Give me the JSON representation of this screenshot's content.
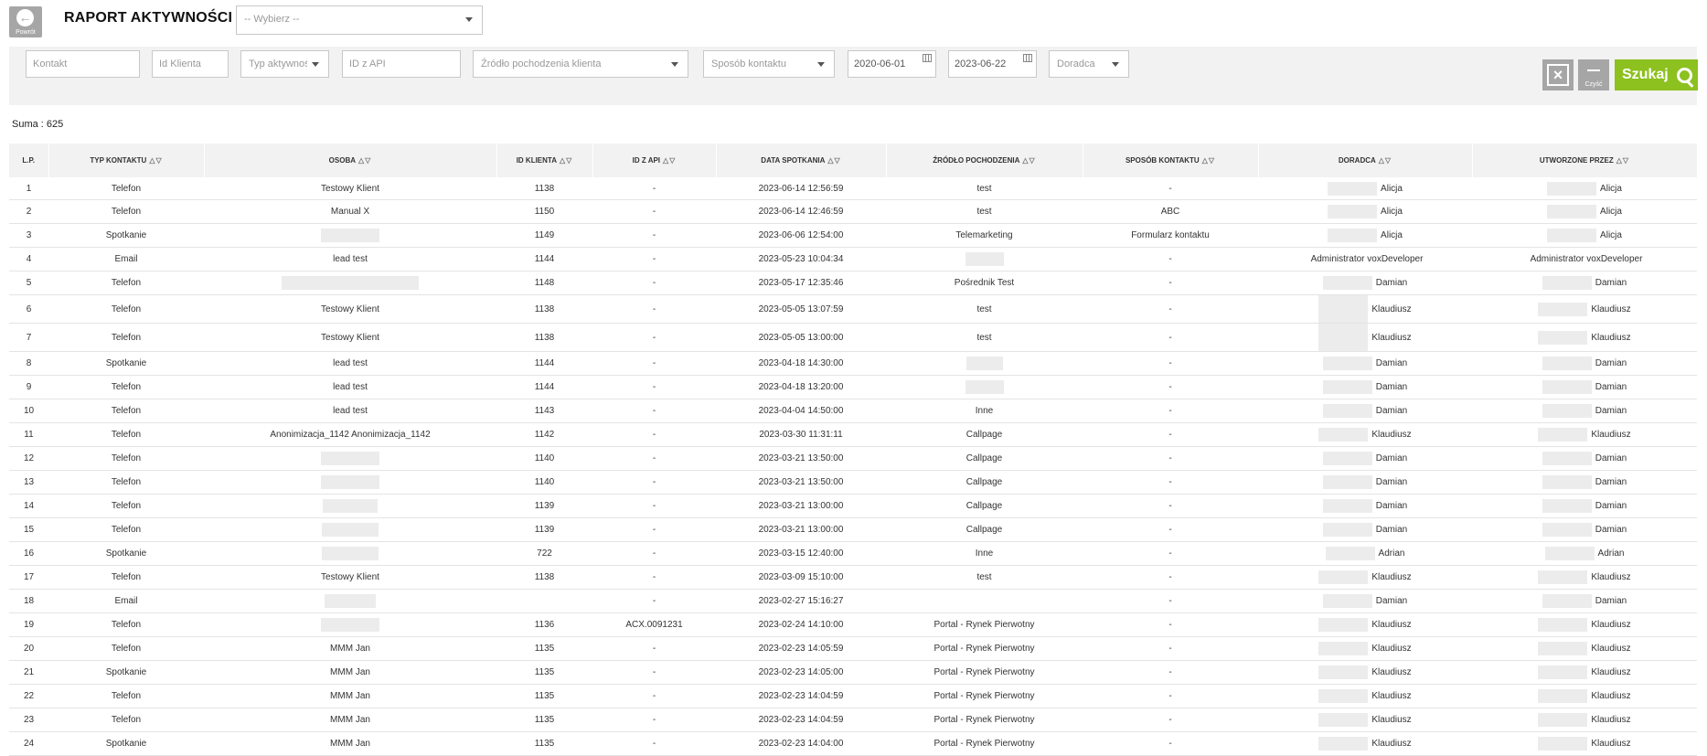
{
  "header": {
    "back_label": "Powrót",
    "title": "RAPORT AKTYWNOŚCI",
    "report_select": "-- Wybierz --"
  },
  "filters": {
    "kontakt_placeholder": "Kontakt",
    "id_klienta_placeholder": "Id Klienta",
    "typ_aktywnosci": "Typ aktywności",
    "id_z_api_placeholder": "ID z API",
    "zrodlo": "Źródło pochodzenia klienta",
    "sposob_kontaktu": "Sposób kontaktu",
    "date_from": "2020-06-01",
    "date_to": "2023-06-22",
    "doradca": "Doradca",
    "clear_label": "Czyść",
    "search_label": "Szukaj"
  },
  "summary": "Suma : 625",
  "table": {
    "columns": [
      "L.P.",
      "TYP KONTAKTU",
      "OSOBA",
      "ID KLIENTA",
      "ID Z API",
      "DATA SPOTKANIA",
      "ŹRÓDŁO POCHODZENIA",
      "SPOSÓB KONTAKTU",
      "DORADCA",
      "UTWORZONE PRZEZ"
    ],
    "rows": [
      [
        "1",
        "Telefon",
        "Testowy Klient",
        "1138",
        "-",
        "2023-06-14 12:56:59",
        "test",
        "-",
        "Alicja",
        "Alicja"
      ],
      [
        "2",
        "Telefon",
        "Manual X",
        "1150",
        "-",
        "2023-06-14 12:46:59",
        "test",
        "ABC",
        "Alicja",
        "Alicja"
      ],
      [
        "3",
        "Spotkanie",
        "",
        "1149",
        "-",
        "2023-06-06 12:54:00",
        "Telemarketing",
        "Formularz kontaktu",
        "Alicja",
        "Alicja"
      ],
      [
        "4",
        "Email",
        "lead test",
        "1144",
        "-",
        "2023-05-23 10:04:34",
        "",
        "-",
        "Administrator voxDeveloper",
        "Administrator voxDeveloper"
      ],
      [
        "5",
        "Telefon",
        "",
        "1148",
        "-",
        "2023-05-17 12:35:46",
        "Pośrednik Test",
        "-",
        "Damian",
        "Damian"
      ],
      [
        "6",
        "Telefon",
        "Testowy Klient",
        "1138",
        "-",
        "2023-05-05 13:07:59",
        "test",
        "-",
        "Klaudiusz",
        "Klaudiusz"
      ],
      [
        "7",
        "Telefon",
        "Testowy Klient",
        "1138",
        "-",
        "2023-05-05 13:00:00",
        "test",
        "-",
        "Klaudiusz",
        "Klaudiusz"
      ],
      [
        "8",
        "Spotkanie",
        "lead test",
        "1144",
        "-",
        "2023-04-18 14:30:00",
        "",
        "-",
        "Damian",
        "Damian"
      ],
      [
        "9",
        "Telefon",
        "lead test",
        "1144",
        "-",
        "2023-04-18 13:20:00",
        "",
        "-",
        "Damian",
        "Damian"
      ],
      [
        "10",
        "Telefon",
        "lead test",
        "1143",
        "-",
        "2023-04-04 14:50:00",
        "Inne",
        "-",
        "Damian",
        "Damian"
      ],
      [
        "11",
        "Telefon",
        "Anonimizacja_1142 Anonimizacja_1142",
        "1142",
        "-",
        "2023-03-30 11:31:11",
        "Callpage",
        "-",
        "Klaudiusz",
        "Klaudiusz"
      ],
      [
        "12",
        "Telefon",
        "",
        "1140",
        "-",
        "2023-03-21 13:50:00",
        "Callpage",
        "-",
        "Damian",
        "Damian"
      ],
      [
        "13",
        "Telefon",
        "",
        "1140",
        "-",
        "2023-03-21 13:50:00",
        "Callpage",
        "-",
        "Damian",
        "Damian"
      ],
      [
        "14",
        "Telefon",
        "",
        "1139",
        "-",
        "2023-03-21 13:00:00",
        "Callpage",
        "-",
        "Damian",
        "Damian"
      ],
      [
        "15",
        "Telefon",
        "",
        "1139",
        "-",
        "2023-03-21 13:00:00",
        "Callpage",
        "-",
        "Damian",
        "Damian"
      ],
      [
        "16",
        "Spotkanie",
        "",
        "722",
        "-",
        "2023-03-15 12:40:00",
        "Inne",
        "-",
        "Adrian",
        "Adrian"
      ],
      [
        "17",
        "Telefon",
        "Testowy Klient",
        "1138",
        "-",
        "2023-03-09 15:10:00",
        "test",
        "-",
        "Klaudiusz",
        "Klaudiusz"
      ],
      [
        "18",
        "Email",
        "",
        "",
        "-",
        "2023-02-27 15:16:27",
        "",
        "-",
        "Damian",
        "Damian"
      ],
      [
        "19",
        "Telefon",
        "",
        "1136",
        "ACX.0091231",
        "2023-02-24 14:10:00",
        "Portal - Rynek Pierwotny",
        "-",
        "Klaudiusz",
        "Klaudiusz"
      ],
      [
        "20",
        "Telefon",
        "MMM Jan",
        "1135",
        "-",
        "2023-02-23 14:05:59",
        "Portal - Rynek Pierwotny",
        "-",
        "Klaudiusz",
        "Klaudiusz"
      ],
      [
        "21",
        "Spotkanie",
        "MMM Jan",
        "1135",
        "-",
        "2023-02-23 14:05:00",
        "Portal - Rynek Pierwotny",
        "-",
        "Klaudiusz",
        "Klaudiusz"
      ],
      [
        "22",
        "Telefon",
        "MMM Jan",
        "1135",
        "-",
        "2023-02-23 14:04:59",
        "Portal - Rynek Pierwotny",
        "-",
        "Klaudiusz",
        "Klaudiusz"
      ],
      [
        "23",
        "Telefon",
        "MMM Jan",
        "1135",
        "-",
        "2023-02-23 14:04:59",
        "Portal - Rynek Pierwotny",
        "-",
        "Klaudiusz",
        "Klaudiusz"
      ],
      [
        "24",
        "Spotkanie",
        "MMM Jan",
        "1135",
        "-",
        "2023-02-23 14:04:00",
        "Portal - Rynek Pierwotny",
        "-",
        "Klaudiusz",
        "Klaudiusz"
      ]
    ]
  },
  "colors": {
    "search_button": "#8cc11f",
    "gray_button": "#a6a6a6",
    "filter_bar": "#f2f2f2",
    "redaction": "#ececec"
  },
  "icons": {
    "back": "arrow-left-circle-icon",
    "calendar": "calendar-icon",
    "close": "close-box-icon",
    "clear": "minus-icon",
    "search": "search-icon",
    "sort": "sort-arrows-icon"
  }
}
